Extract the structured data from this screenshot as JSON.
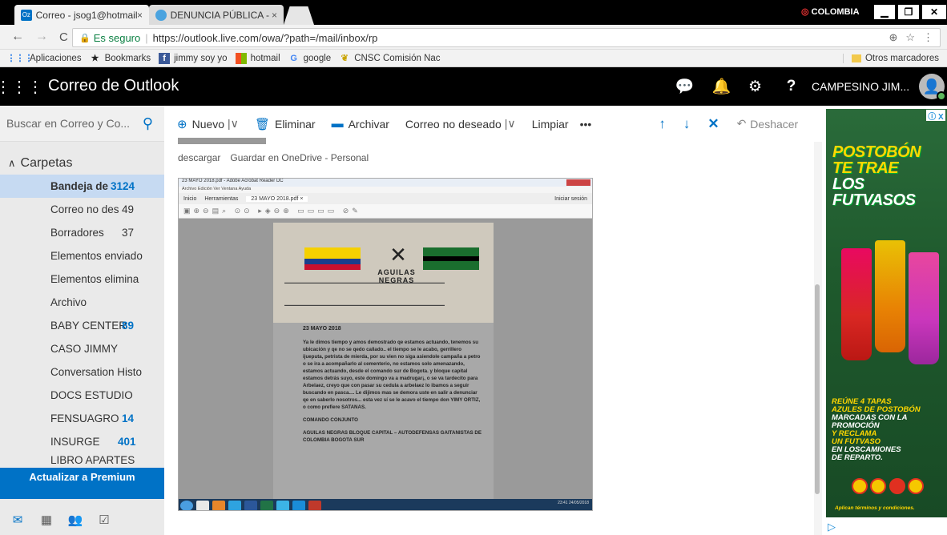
{
  "browser": {
    "tabs": [
      {
        "label": "Correo - jsog1@hotmail.",
        "close": "×"
      },
      {
        "label": "DENUNCIA PÚBLICA - FA",
        "close": "×"
      }
    ],
    "window_label": "COLOMBIA",
    "address": {
      "secure_label": "Es seguro",
      "url": "https://outlook.live.com/owa/?path=/mail/inbox/rp"
    },
    "bookmarks": [
      {
        "label": "Aplicaciones",
        "icon": "apps-grid-icon"
      },
      {
        "label": "Bookmarks",
        "icon": "star-icon"
      },
      {
        "label": "jimmy soy yo",
        "icon": "facebook-icon"
      },
      {
        "label": "hotmail",
        "icon": "windows-icon"
      },
      {
        "label": "google",
        "icon": "google-icon"
      },
      {
        "label": "CNSC Comisión Nac",
        "icon": "cnsc-icon"
      }
    ],
    "other_bookmarks": "Otros marcadores"
  },
  "outlook": {
    "title": "Correo de Outlook",
    "account_name": "CAMPESINO JIM...",
    "search_placeholder": "Buscar en Correo y Co...",
    "folders_header": "Carpetas",
    "folders": [
      {
        "label": "Bandeja de",
        "count": "3124"
      },
      {
        "label": "Correo no des",
        "count": "49"
      },
      {
        "label": "Borradores",
        "count": "37"
      },
      {
        "label": "Elementos enviado",
        "count": ""
      },
      {
        "label": "Elementos elimina",
        "count": ""
      },
      {
        "label": "Archivo",
        "count": ""
      },
      {
        "label": "BABY CENTER",
        "count": "89"
      },
      {
        "label": "CASO JIMMY",
        "count": ""
      },
      {
        "label": "Conversation Histo",
        "count": ""
      },
      {
        "label": "DOCS ESTUDIO",
        "count": ""
      },
      {
        "label": "FENSUAGRO",
        "count": "14"
      },
      {
        "label": "INSURGE",
        "count": "401"
      },
      {
        "label": "LIBRO APARTES",
        "count": ""
      }
    ],
    "premium_label": "Actualizar a Premium",
    "commands": {
      "new": "Nuevo",
      "delete": "Eliminar",
      "archive": "Archivar",
      "junk": "Correo no deseado",
      "sweep": "Limpiar",
      "more": "•••",
      "undo": "Deshacer"
    },
    "attachment_actions": [
      "descargar",
      "Guardar en OneDrive - Personal"
    ]
  },
  "pdf": {
    "window_title": "23 MAYO 2018.pdf - Adobe Acrobat Reader DC",
    "menu": "Archivo  Edición  Ver  Ventana  Ayuda",
    "tabs": [
      "Inicio",
      "Herramientas",
      "23 MAYO 2018.pdf  ×"
    ],
    "login": "Iniciar sesión",
    "header_text": "AGUILAS NEGRAS",
    "date": "23 MAYO 2018",
    "paragraphs": [
      "Ya le dimos tiempo y amos demostrado qe estamos actuando, tenemos su ubicación y qe no se qedo callado.. el tiempo se le acabo, gerrillero ijueputa, petrista de mierda, por su vien no siga asiendole campaña a petro o se ira a acompañarlo al cementerio, no estamos solo amenazando, estamos actuando, desde el comando sur de Bogota. y bloque capital estamos detrás suyo, este domingo va a madrugar¡, o se va tardecito para Arbelaez, creyo que con pasar su cedula a arbelaez lo ibamos a seguir buscando en pasca.... Le dijimos mas se demora uste en salir a denunciar qe en saberlo nosotros... esta vez sí se le acavo el tiempo don YIMY ORTIZ, o como prefiere SATANAS.",
      "COMANDO CONJUNTO",
      "AGUILAS NEGRAS BLOQUE CAPITAL – AUTODEFENSAS GAITANISTAS DE COLOMBIA BOGOTA SUR"
    ],
    "clock": "23:41\n24/05/2018"
  },
  "ad": {
    "title_lines": [
      "POSTOBÓN",
      "TE TRAE",
      "LOS",
      "FUTVASOS"
    ],
    "footer_lines": [
      "REÚNE 4 TAPAS",
      "AZULES DE POSTOBÓN",
      "MARCADAS CON LA",
      "PROMOCIÓN",
      "Y RECLAMA",
      "UN FUTVASO",
      "EN LOSCAMIONES",
      "DE REPARTO."
    ],
    "terms": "Aplican términos y condiciones.",
    "choice": "ⓘ X"
  },
  "colors": {
    "accent": "#0072c6",
    "header": "#000000",
    "selected": "#c6daf2"
  }
}
